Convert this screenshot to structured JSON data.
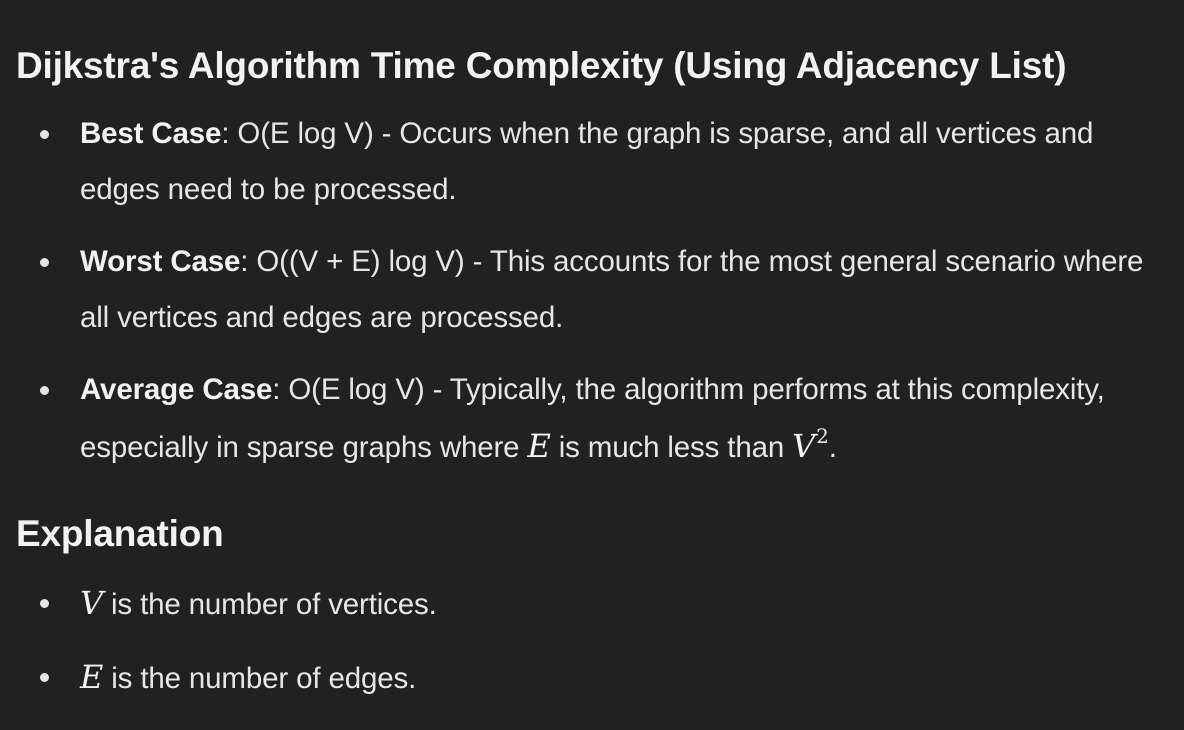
{
  "sections": {
    "complexity_heading": "Dijkstra's Algorithm Time Complexity (Using Adjacency List)",
    "explanation_heading": "Explanation"
  },
  "cases": [
    {
      "label": "Best Case",
      "sep": ": ",
      "text": "O(E log V) - Occurs when the graph is sparse, and all vertices and edges need to be processed."
    },
    {
      "label": "Worst Case",
      "sep": ": ",
      "text": "O((V + E) log V) - This accounts for the most general scenario where all vertices and edges are processed."
    },
    {
      "label": "Average Case",
      "sep": ": ",
      "text_before": "O(E log V) - Typically, the algorithm performs at this complexity, especially in sparse graphs where ",
      "math_e": "E",
      "text_middle": " is much less than ",
      "math_v": "V",
      "math_exp": "2",
      "text_after": "."
    }
  ],
  "explanation": [
    {
      "math": "V",
      "text": " is the number of vertices."
    },
    {
      "math": "E",
      "text": " is the number of edges."
    }
  ]
}
